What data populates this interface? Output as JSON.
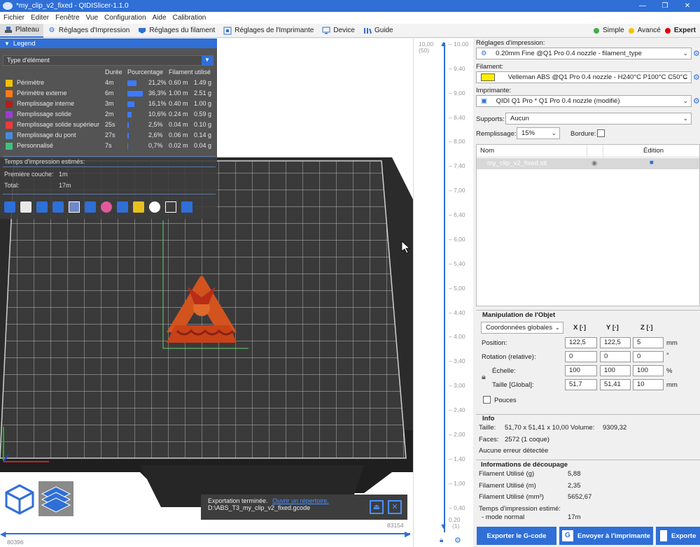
{
  "window": {
    "title": "*my_clip_v2_fixed - QIDISlicer-1.1.0"
  },
  "menu": [
    "Fichier",
    "Editer",
    "Fenêtre",
    "Vue",
    "Configuration",
    "Aide",
    "Calibration"
  ],
  "tabs": [
    {
      "label": "Plateau",
      "icon": "plate-icon"
    },
    {
      "label": "Réglages d'Impression",
      "icon": "gear-icon"
    },
    {
      "label": "Réglages du filament",
      "icon": "filament-icon"
    },
    {
      "label": "Réglages de l'Imprimante",
      "icon": "printer-icon"
    },
    {
      "label": "Device",
      "icon": "device-icon"
    },
    {
      "label": "Guide",
      "icon": "guide-icon"
    }
  ],
  "modes": [
    {
      "label": "Simple",
      "color": "#3cb043"
    },
    {
      "label": "Avancé",
      "color": "#f2c200"
    },
    {
      "label": "Expert",
      "color": "#e00000"
    }
  ],
  "legend": {
    "title": "Legend",
    "type_select": "Type d'élément",
    "headers": {
      "duration": "Durée",
      "percent": "Pourcentage",
      "filament": "Filament utilisé"
    },
    "rows": [
      {
        "label": "Périmètre",
        "color": "#f2c200",
        "duration": "4m",
        "percent": "21,2%",
        "pct_value": 21.2,
        "meters": "0.60 m",
        "grams": "1.49 g"
      },
      {
        "label": "Périmètre externe",
        "color": "#ff7b1a",
        "duration": "6m",
        "percent": "36,3%",
        "pct_value": 36.3,
        "meters": "1.00 m",
        "grams": "2.51 g"
      },
      {
        "label": "Remplissage interne",
        "color": "#b0201a",
        "duration": "3m",
        "percent": "16,1%",
        "pct_value": 16.1,
        "meters": "0.40 m",
        "grams": "1.00 g"
      },
      {
        "label": "Remplissage solide",
        "color": "#9a3ed4",
        "duration": "2m",
        "percent": "10,6%",
        "pct_value": 10.6,
        "meters": "0.24 m",
        "grams": "0.59 g"
      },
      {
        "label": "Remplissage solide supérieur",
        "color": "#ef3a3a",
        "duration": "25s",
        "percent": "2,5%",
        "pct_value": 2.5,
        "meters": "0.04 m",
        "grams": "0.10 g"
      },
      {
        "label": "Remplissage du pont",
        "color": "#4a8bd6",
        "duration": "27s",
        "percent": "2,6%",
        "pct_value": 2.6,
        "meters": "0.06 m",
        "grams": "0.14 g"
      },
      {
        "label": "Personnalisé",
        "color": "#40c080",
        "duration": "7s",
        "percent": "0,7%",
        "pct_value": 0.7,
        "meters": "0.02 m",
        "grams": "0.04 g"
      }
    ],
    "time_title": "Temps d'impression estimés:",
    "first_layer_label": "Première couche:",
    "first_layer_value": "1m",
    "total_label": "Total:",
    "total_value": "17m"
  },
  "vertical_slider": {
    "top_value": "10,00",
    "top_layer": "(50)",
    "ticks": [
      "10,00",
      "9,40",
      "9,00",
      "8,40",
      "8,00",
      "7,40",
      "7,00",
      "6,40",
      "6,00",
      "5,40",
      "5,00",
      "4,40",
      "4,00",
      "3,40",
      "3,00",
      "2,40",
      "2,00",
      "1,40",
      "1,00",
      "0,40"
    ],
    "bottom_value": "0,20",
    "bottom_layer": "(1)"
  },
  "horizontal_slider": {
    "left_value": "80396",
    "right_value": "83154"
  },
  "notification": {
    "text": "Exportation terminée.",
    "link": "Ouvrir un répertoire.",
    "path": "D:\\ABS_T3_my_clip_v2_fixed.gcode"
  },
  "right_panel": {
    "print_label": "Réglages d'impression:",
    "print_value": "0.20mm Fine @Q1 Pro 0.4 nozzle - filament_type",
    "filament_label": "Filament:",
    "filament_value": "Velleman ABS @Q1 Pro 0.4 nozzle - H240°C P100°C C50°C",
    "filament_color": "#ffee00",
    "printer_label": "Imprimante:",
    "printer_value": "QIDI Q1 Pro * Q1 Pro 0.4 nozzle (modifié)",
    "supports_label": "Supports:",
    "supports_value": "Aucun",
    "infill_label": "Remplissage:",
    "infill_value": "15%",
    "brim_label": "Bordure:",
    "list_header_name": "Nom",
    "list_header_edit": "Édition",
    "object_name": "my_clip_v2_fixed.stl"
  },
  "manipulation": {
    "title": "Manipulation de l'Objet",
    "coord_select": "Coordonnées globales",
    "axes": [
      "X",
      "Y",
      "Z"
    ],
    "position_label": "Position:",
    "position": [
      "122,5",
      "122,5",
      "5"
    ],
    "position_unit": "mm",
    "rotation_label": "Rotation (relative):",
    "rotation": [
      "0",
      "0",
      "0"
    ],
    "rotation_unit": "°",
    "scale_label": "Échelle:",
    "scale": [
      "100",
      "100",
      "100"
    ],
    "scale_unit": "%",
    "size_label": "Taille [Global]:",
    "size": [
      "51,7",
      "51,41",
      "10"
    ],
    "size_unit": "mm",
    "inches_label": "Pouces"
  },
  "info": {
    "title": "Info",
    "size_label": "Taille:",
    "size_value": "51,70 x 51,41 x 10,00",
    "volume_label": "Volume:",
    "volume_value": "9309,32",
    "faces_label": "Faces:",
    "faces_value": "2572 (1 coque)",
    "errors": "Aucune erreur détectée"
  },
  "slicing": {
    "title": "Informations de découpage",
    "rows": [
      {
        "label": "Filament Utilisé (g)",
        "value": "5,88"
      },
      {
        "label": "Filament Utilisé (m)",
        "value": "2,35"
      },
      {
        "label": "Filament Utilisé (mm³)",
        "value": "5652,67"
      }
    ],
    "time_label": "Temps d'impression estimé:",
    "mode_label": "- mode normal",
    "mode_value": "17m"
  },
  "buttons": {
    "export_gcode": "Exporter le G-code",
    "send_printer": "Envoyer à l'imprimante",
    "export": "Exporte"
  }
}
